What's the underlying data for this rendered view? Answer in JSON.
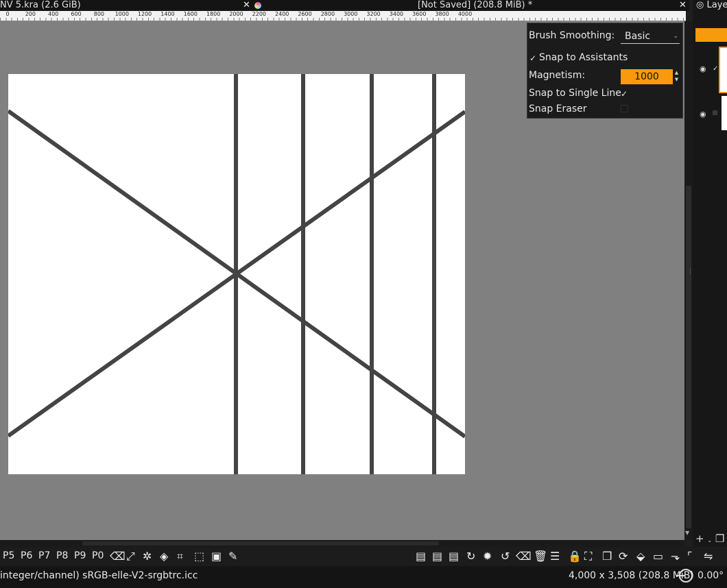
{
  "tabs": {
    "left_title": "NV 5.kra (2.6 GiB)",
    "right_title": "[Not Saved]  (208.8 MiB) *",
    "close_glyph": "✕"
  },
  "ruler": {
    "labels": [
      "0",
      "200",
      "400",
      "600",
      "800",
      "1000",
      "1200",
      "1400",
      "1600",
      "1800",
      "2000",
      "2200",
      "2400",
      "2600",
      "2800",
      "3000",
      "3200",
      "3400",
      "3600",
      "3800",
      "4000"
    ]
  },
  "tool_options": {
    "brush_smoothing_label": "Brush Smoothing:",
    "brush_smoothing_value": "Basic",
    "snap_to_assistants_label": "Snap to Assistants",
    "magnetism_label": "Magnetism:",
    "magnetism_value": "1000",
    "snap_single_line_label": "Snap to Single Line",
    "snap_eraser_label": "Snap Eraser",
    "check_glyph": "✓"
  },
  "layers_docker": {
    "title": "Layers"
  },
  "presets": [
    "P5",
    "P6",
    "P7",
    "P8",
    "P9",
    "P0"
  ],
  "toolbar_icons": {
    "eraser": "⌫",
    "transform": "⤢",
    "magic_wand": "✲",
    "fill": "◈",
    "crop": "⌗",
    "select_rect": "⬚",
    "gradient": "▣",
    "brush": "✎",
    "r1": "▤",
    "r2": "▤",
    "r3": "▤",
    "redo": "↻",
    "gear": "✹",
    "undo": "↺",
    "clear": "⌫",
    "trash": "🗑",
    "sliders": "☰",
    "lock": "🔒",
    "fit": "⛶",
    "copy": "❐",
    "refresh": "⟳",
    "bucket": "⬙",
    "folder": "▭",
    "arrow_box": "⬎",
    "corners": "⌜",
    "mirror": "⇋"
  },
  "status": {
    "color_profile": "integer/channel)  sRGB-elle-V2-srgbtrc.icc",
    "image_size": "4,000 x 3,508 (208.8 MiB)",
    "rotation": "0.00°"
  },
  "colors": {
    "accent": "#f79a0b",
    "canvas_bg": "#808080",
    "line_color": "#444444"
  }
}
